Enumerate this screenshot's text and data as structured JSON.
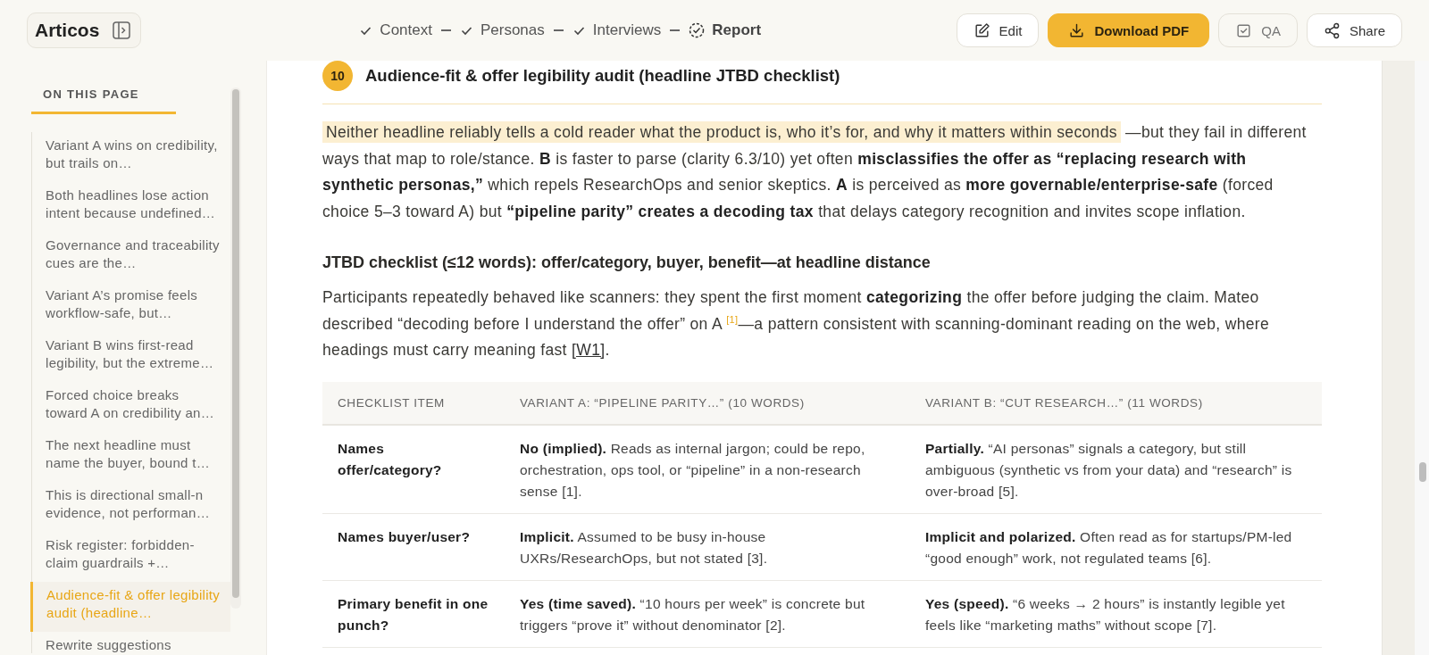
{
  "app": {
    "name": "Articos"
  },
  "steps": [
    {
      "label": "Context",
      "current": false
    },
    {
      "label": "Personas",
      "current": false
    },
    {
      "label": "Interviews",
      "current": false
    },
    {
      "label": "Report",
      "current": true
    }
  ],
  "actions": [
    {
      "label": "Edit",
      "kind": "edit",
      "primary": false,
      "disabled": false
    },
    {
      "label": "Download PDF",
      "kind": "download",
      "primary": true,
      "disabled": false
    },
    {
      "label": "QA",
      "kind": "qa",
      "primary": false,
      "disabled": true
    },
    {
      "label": "Share",
      "kind": "share",
      "primary": false,
      "disabled": false
    }
  ],
  "sidebar": {
    "title": "ON THIS PAGE",
    "items": [
      {
        "text": "Variant A wins on credibility, but trails on…",
        "selected": false
      },
      {
        "text": "Both headlines lose action intent because undefined…",
        "selected": false
      },
      {
        "text": "Governance and traceability cues are the…",
        "selected": false
      },
      {
        "text": "Variant A’s promise feels workflow-safe, but…",
        "selected": false
      },
      {
        "text": "Variant B wins first-read legibility, but the extreme…",
        "selected": false
      },
      {
        "text": "Forced choice breaks toward A on credibility an…",
        "selected": false
      },
      {
        "text": "The next headline must name the buyer, bound t…",
        "selected": false
      },
      {
        "text": "This is directional small-n evidence, not performan…",
        "selected": false
      },
      {
        "text": "Risk register: forbidden-claim guardrails +…",
        "selected": false
      },
      {
        "text": "Audience-fit & offer legibility audit (headline…",
        "selected": true
      },
      {
        "text": "Rewrite suggestions",
        "selected": false
      }
    ]
  },
  "section": {
    "number": "10",
    "title": "Audience-fit & offer legibility audit (headline JTBD checklist)",
    "summary": {
      "highlight": "Neither headline reliably tells a cold reader what the product is, who it’s for, and why it matters within seconds",
      "rest": "—but they fail in different ways that map to role/stance. **B** is faster to parse (clarity 6.3/10) yet often **misclassifies the offer as “replacing research with synthetic personas,”** which repels ResearchOps and senior skeptics. **A** is perceived as **more governable/enterprise-safe** (forced choice 5–3 toward A) but **“pipeline parity” creates a decoding tax** that delays category recognition and invites scope inflation."
    },
    "subheading": "JTBD checklist (≤12 words): offer/category, buyer, benefit—at headline distance",
    "body": {
      "text": "Participants repeatedly behaved like scanners: they spent the first moment **categorizing** the offer before judging the claim. Mateo described “decoding before I understand the offer” on A $^{[1]}$—a pattern consistent with scanning-dominant reading on the web, where headings must carry meaning fast",
      "link": "[W1]",
      "end": "."
    },
    "table": {
      "columns": [
        "CHECKLIST ITEM",
        "VARIANT A: “PIPELINE PARITY…” (10 WORDS)",
        "VARIANT B: “CUT RESEARCH…” (11 WORDS)"
      ],
      "rows": [
        [
          "Names offer/category?",
          "**No (implied).** Reads as internal jargon; could be repo, orchestration, ops tool, or “pipeline” in a non-research sense [1].",
          "**Partially.** “AI personas” signals a category, but still ambiguous (synthetic vs from your data) and “research” is over-broad [5]."
        ],
        [
          "Names buyer/user?",
          "**Implicit.** Assumed to be busy in-house UXRs/ResearchOps, but not stated [3].",
          "**Implicit and polarized.** Often read as for startups/PM-led “good enough” work, not regulated teams [6]."
        ],
        [
          "Primary benefit in one punch?",
          "**Yes (time saved).** “10 hours per week” is concrete but triggers “prove it” without denominator [2].",
          "**Yes (speed).** “6 weeks → 2 hours” is instantly legible yet feels like “marketing maths” without scope [7]."
        ]
      ]
    }
  }
}
